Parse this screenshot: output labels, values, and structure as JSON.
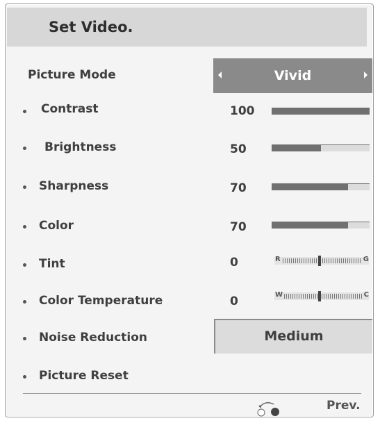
{
  "header": {
    "title": "Set Video."
  },
  "rows": {
    "picture_mode": {
      "label": "Picture Mode",
      "value": "Vivid"
    },
    "contrast": {
      "label": "Contrast",
      "value": "100",
      "level": 1.0
    },
    "brightness": {
      "label": "Brightness",
      "value": "50",
      "level": 0.5
    },
    "sharpness": {
      "label": "Sharpness",
      "value": "70",
      "level": 0.78
    },
    "color": {
      "label": "Color",
      "value": "70",
      "level": 0.78
    },
    "tint": {
      "label": "Tint",
      "value": "0",
      "scale_left": "R",
      "scale_right": "G"
    },
    "color_temperature": {
      "label": "Color Temperature",
      "value": "0",
      "scale_left": "W",
      "scale_right": "C"
    },
    "noise_reduction": {
      "label": "Noise Reduction",
      "value": "Medium"
    },
    "picture_reset": {
      "label": "Picture Reset"
    }
  },
  "footer": {
    "prev_label": "Prev.",
    "icon": "return-icon"
  },
  "colors": {
    "bar_fill": "#707070",
    "bar_track": "#dcdcdc",
    "selected": "#8a8a8a"
  }
}
